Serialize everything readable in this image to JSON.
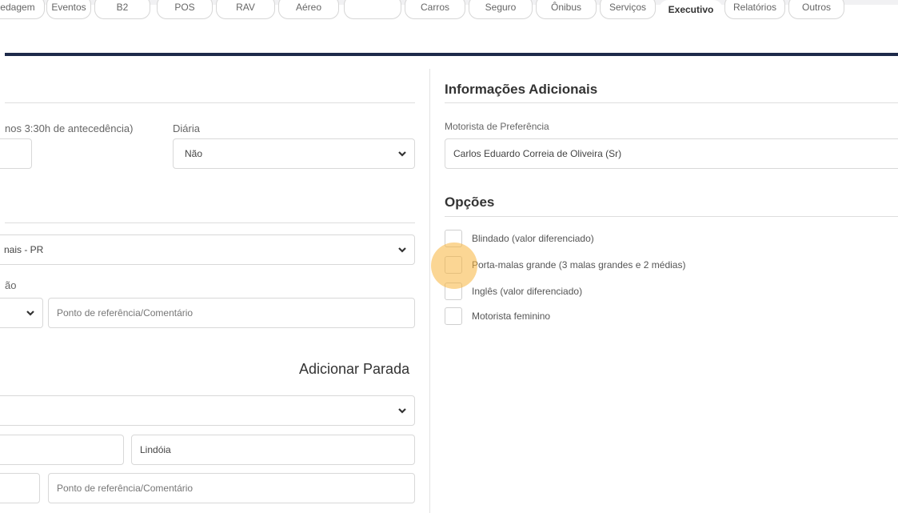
{
  "nav": {
    "tabs": [
      {
        "label": "Hospedagem"
      },
      {
        "label": "Eventos"
      },
      {
        "label": "B2"
      },
      {
        "label": "POS"
      },
      {
        "label": "RAV"
      },
      {
        "label": "Aéreo"
      },
      {
        "label": ""
      },
      {
        "label": "Carros"
      },
      {
        "label": "Seguro"
      },
      {
        "label": "Ônibus"
      },
      {
        "label": "Serviços"
      },
      {
        "label": "Executivo"
      },
      {
        "label": "Relatórios"
      },
      {
        "label": "Outros"
      }
    ],
    "active": "Executivo"
  },
  "left": {
    "antecedencia_label": "nos 3:30h de antecedência)",
    "diaria_label": "Diária",
    "diaria_value": "Não",
    "city_value": "nais - PR",
    "partial_label": "ão",
    "ref_placeholder_1": "Ponto de referência/Comentário",
    "add_stop_label": "Adicionar Parada",
    "city2_value": "Lindóia",
    "ref_placeholder_2": "Ponto de referência/Comentário"
  },
  "right": {
    "info_heading": "Informações Adicionais",
    "driver_label": "Motorista de Preferência",
    "driver_value": "Carlos Eduardo Correia de Oliveira (Sr)",
    "options_heading": "Opções",
    "options": [
      {
        "label": "Blindado (valor diferenciado)",
        "checked": false
      },
      {
        "label": "Porta-malas grande (3 malas grandes e 2 médias)",
        "checked": false
      },
      {
        "label": "Inglês (valor diferenciado)",
        "checked": false
      },
      {
        "label": "Motorista feminino",
        "checked": false
      }
    ]
  },
  "icons": {
    "select_chevron": "chevron-down-icon"
  },
  "colors": {
    "header_line": "#1e2a4a",
    "highlight": "#f7b43c",
    "text_primary": "#333333"
  }
}
